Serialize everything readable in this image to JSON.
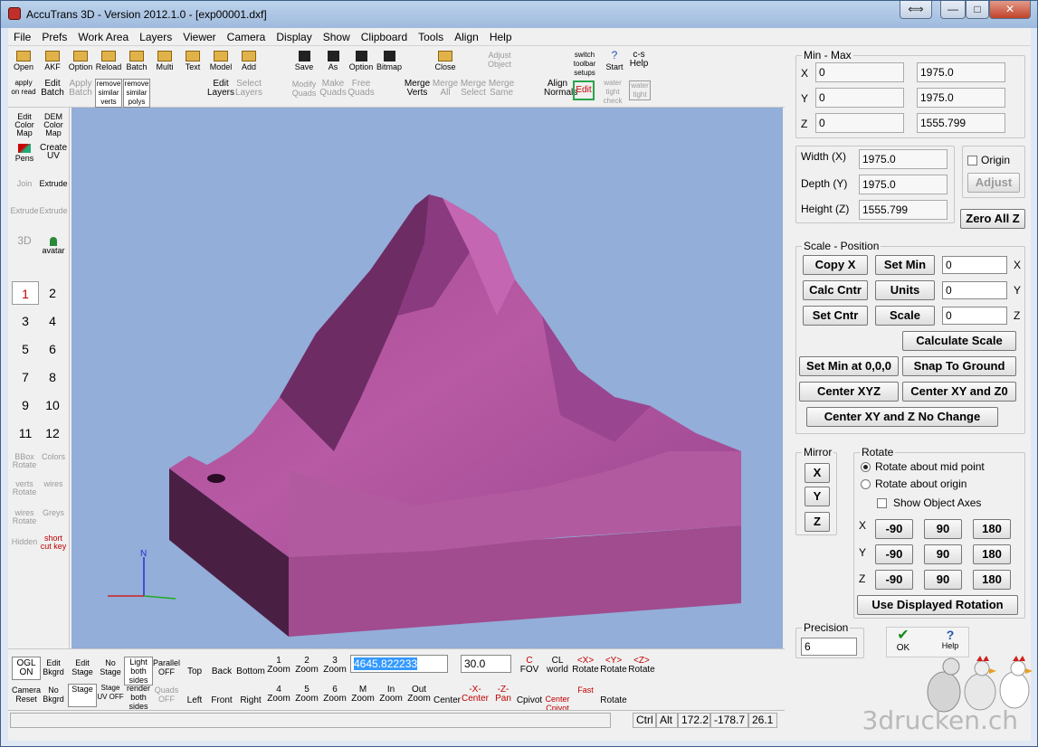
{
  "window": {
    "title": "AccuTrans 3D - Version 2012.1.0 - [exp00001.dxf]"
  },
  "titlebar_buttons": {
    "restore": "⟺",
    "minimize": "—",
    "maximize": "□",
    "close": "✕"
  },
  "menu": [
    "File",
    "Prefs",
    "Work Area",
    "Layers",
    "Viewer",
    "Camera",
    "Display",
    "Show",
    "Clipboard",
    "Tools",
    "Align",
    "Help"
  ],
  "toolbar": {
    "row1": [
      "Open",
      "AKF",
      "Option",
      "Reload",
      "Batch",
      "Multi",
      "Text",
      "Model",
      "Add",
      "Save",
      "As",
      "Option",
      "Bitmap",
      "Close",
      "Adjust Object",
      "switch toolbar setups",
      "Start",
      "c-s Help"
    ],
    "row2": [
      "apply on read",
      "Edit Batch",
      "Apply Batch",
      "remove similar verts",
      "remove similar polys",
      "Edit Layers",
      "Select Layers",
      "Modify Quads",
      "Make Quads",
      "Free Quads",
      "Merge Verts",
      "Merge All",
      "Merge Select",
      "Merge Same",
      "Align Normals",
      "Edit",
      "water tight check",
      "water tight"
    ]
  },
  "sidebar": {
    "tools": [
      "Edit Color Map",
      "DEM Color Map",
      "Pens",
      "Create UV",
      "Join",
      "Extrude",
      "Extrude",
      "Extrude",
      "3D",
      "avatar"
    ],
    "tools_bottom": [
      "BBox Rotate",
      "Colors",
      "verts Rotate",
      "wires",
      "wires Rotate",
      "Greys",
      "Hidden",
      "short cut key"
    ],
    "numbers": [
      "1",
      "2",
      "3",
      "4",
      "5",
      "6",
      "7",
      "8",
      "9",
      "10",
      "11",
      "12"
    ]
  },
  "axes": {
    "n": "N"
  },
  "bottombar": {
    "row1": [
      "OGL ON",
      "Edit Bkgrd",
      "Edit Stage",
      "No Stage",
      "Light both sides",
      "Parallel OFF",
      "Top",
      "Back",
      "Bottom",
      "Zoom",
      "Zoom",
      "Zoom",
      "FOV",
      "world",
      "Rotate",
      "Rotate",
      "Rotate"
    ],
    "row1_tops": [
      "1",
      "2",
      "3",
      "C",
      "CL",
      "<X>",
      "<Y>",
      "<Z>"
    ],
    "row2": [
      "Camera Reset",
      "No Bkgrd",
      "Stage",
      "Stage UV OFF",
      "render both sides",
      "Quads OFF",
      "Left",
      "Front",
      "Right",
      "Zoom",
      "Zoom",
      "Zoom",
      "Zoom",
      "Zoom",
      "Zoom",
      "Center",
      "Center",
      "Pan",
      "Cpivot",
      "Center Cpivot",
      "Fast",
      "Rotate"
    ],
    "row2_tops": [
      "4",
      "5",
      "6",
      "M",
      "In",
      "Out",
      "-X-",
      "-Z-"
    ],
    "zoom_value": "4645.822233",
    "fov_value": "30.0"
  },
  "status": {
    "ctrl": "Ctrl",
    "alt": "Alt",
    "v1": "172.2",
    "v2": "-178.7",
    "v3": "26.1"
  },
  "minmax": {
    "legend": "Min - Max",
    "x_min": "0",
    "x_max": "1975.0",
    "y_min": "0",
    "y_max": "1975.0",
    "z_min": "0",
    "z_max": "1555.799",
    "x": "X",
    "y": "Y",
    "z": "Z"
  },
  "dims": {
    "width_label": "Width (X)",
    "width": "1975.0",
    "depth_label": "Depth (Y)",
    "depth": "1975.0",
    "height_label": "Height (Z)",
    "height": "1555.799",
    "origin": "Origin",
    "adjust": "Adjust",
    "zero_all_z": "Zero All Z"
  },
  "scale": {
    "legend": "Scale - Position",
    "copy_x": "Copy X",
    "set_min": "Set Min",
    "calc_cntr": "Calc Cntr",
    "units": "Units",
    "set_cntr": "Set Cntr",
    "scale": "Scale",
    "in_x": "0",
    "in_y": "0",
    "in_z": "0",
    "x": "X",
    "y": "Y",
    "z": "Z",
    "calculate_scale": "Calculate Scale",
    "set_min_000": "Set Min at 0,0,0",
    "snap": "Snap To Ground",
    "center_xyz": "Center XYZ",
    "center_xy_z0": "Center XY and Z0",
    "center_xy_nochange": "Center XY and Z No Change"
  },
  "mirror": {
    "legend": "Mirror",
    "x": "X",
    "y": "Y",
    "z": "Z"
  },
  "rotate": {
    "legend": "Rotate",
    "mid": "Rotate about mid point",
    "origin": "Rotate about origin",
    "show_axes": "Show Object Axes",
    "x": "X",
    "y": "Y",
    "z": "Z",
    "m90": "-90",
    "p90": "90",
    "p180": "180",
    "use_displayed": "Use Displayed Rotation"
  },
  "precision": {
    "legend": "Precision",
    "value": "6"
  },
  "ok": "OK",
  "help": "Help",
  "watermark": "3drucken.ch"
}
